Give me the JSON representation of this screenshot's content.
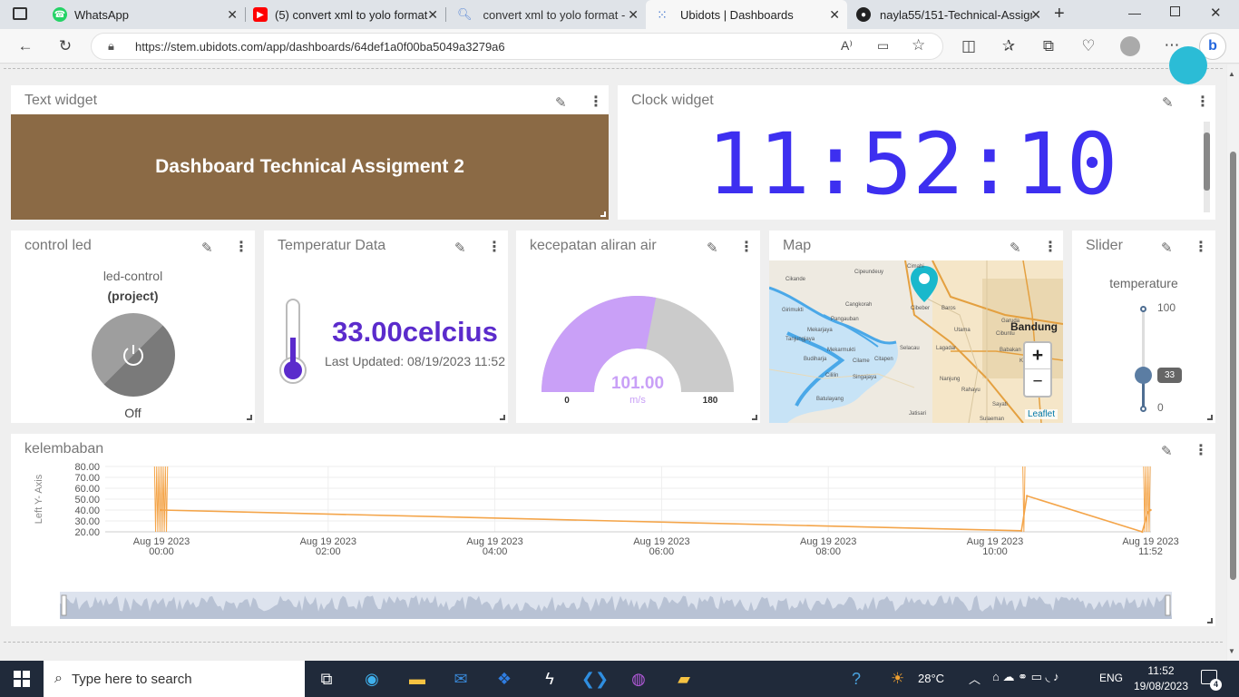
{
  "browser": {
    "tabs": [
      {
        "label": "WhatsApp",
        "icon": "whatsapp-icon"
      },
      {
        "label": "(5) convert xml to yolo format",
        "icon": "youtube-icon"
      },
      {
        "label": "convert xml to yolo format - S",
        "icon": "search-icon"
      },
      {
        "label": "Ubidots | Dashboards",
        "icon": "ubidots-icon",
        "active": true
      },
      {
        "label": "nayla55/151-Technical-Assign",
        "icon": "github-icon"
      }
    ],
    "url": "https://stem.ubidots.com/app/dashboards/64def1a0f00ba5049a3279a6"
  },
  "widgets": {
    "text": {
      "title": "Text widget",
      "content": "Dashboard Technical Assigment 2",
      "bg": "#8b6a45"
    },
    "clock": {
      "title": "Clock widget",
      "time": "11:52:10",
      "color": "#3d2ff0"
    },
    "led": {
      "title": "control led",
      "device": "led-control",
      "project": "(project)",
      "state": "Off"
    },
    "temperature": {
      "title": "Temperatur Data",
      "value": "33.00celcius",
      "updated": "Last Updated: 08/19/2023 11:52",
      "color": "#5b2bcc"
    },
    "gauge": {
      "title": "kecepatan aliran air",
      "value": "101.00",
      "unit": "m/s",
      "min": "0",
      "max": "180",
      "fraction": 0.561,
      "fill": "#c9a0f7"
    },
    "map": {
      "title": "Map",
      "places": [
        "Cimahi",
        "Cikande",
        "Cipeundeuy",
        "Cangkorah",
        "Girimukti",
        "Cibeber",
        "Baros",
        "Pangauban",
        "Mekarjaya",
        "Utama",
        "Garuda",
        "Cibuntu",
        "Bandung",
        "Tanjungjaya",
        "Mekarmukti",
        "Cilame",
        "Selacau",
        "Lagadar",
        "Babakan",
        "Kopo",
        "Budiharja",
        "Citapen",
        "Cililin",
        "Singajaya",
        "Nanjung",
        "Rahayu",
        "Batulayang",
        "Jatisari",
        "Sayati",
        "Sulaeman"
      ],
      "attribution": "Leaflet",
      "zoom_in": "+",
      "zoom_out": "−"
    },
    "slider": {
      "title": "Slider",
      "label": "temperature",
      "max": "100",
      "min": "0",
      "value": "33",
      "level": 0.33
    },
    "kelembaban": {
      "title": "kelembaban",
      "ylabel": "Left Y- Axis"
    }
  },
  "chart_data": {
    "type": "line",
    "title": "kelembaban",
    "ylabel": "Left Y- Axis",
    "ylim": [
      20,
      80
    ],
    "yticks": [
      "80.00",
      "70.00",
      "60.00",
      "50.00",
      "40.00",
      "30.00",
      "20.00"
    ],
    "xticks": [
      {
        "date": "Aug 19 2023",
        "time": "00:00"
      },
      {
        "date": "Aug 19 2023",
        "time": "02:00"
      },
      {
        "date": "Aug 19 2023",
        "time": "04:00"
      },
      {
        "date": "Aug 19 2023",
        "time": "06:00"
      },
      {
        "date": "Aug 19 2023",
        "time": "08:00"
      },
      {
        "date": "Aug 19 2023",
        "time": "10:00"
      },
      {
        "date": "Aug 19 2023",
        "time": "11:52"
      }
    ],
    "series": [
      {
        "color": "#f4a54a",
        "x": [
          "2023-08-19 00:00",
          "2023-08-19 10:19",
          "2023-08-19 10:23",
          "2023-08-19 11:46",
          "2023-08-19 11:50",
          "2023-08-19 11:52"
        ],
        "y": [
          40,
          21,
          53,
          20,
          38,
          40
        ]
      }
    ],
    "bursts": [
      {
        "from": "2023-08-18 23:55",
        "to": "2023-08-19 00:05",
        "low": 20,
        "high": 80
      },
      {
        "from": "2023-08-19 10:20",
        "to": "2023-08-19 10:22",
        "low": 20,
        "high": 80
      },
      {
        "from": "2023-08-19 11:47",
        "to": "2023-08-19 11:52",
        "low": 20,
        "high": 80
      }
    ],
    "grid": true
  },
  "taskbar": {
    "search_placeholder": "Type here to search",
    "weather": "28°C",
    "lang": "ENG",
    "time": "11:52",
    "date": "19/08/2023",
    "notifications": "4"
  }
}
